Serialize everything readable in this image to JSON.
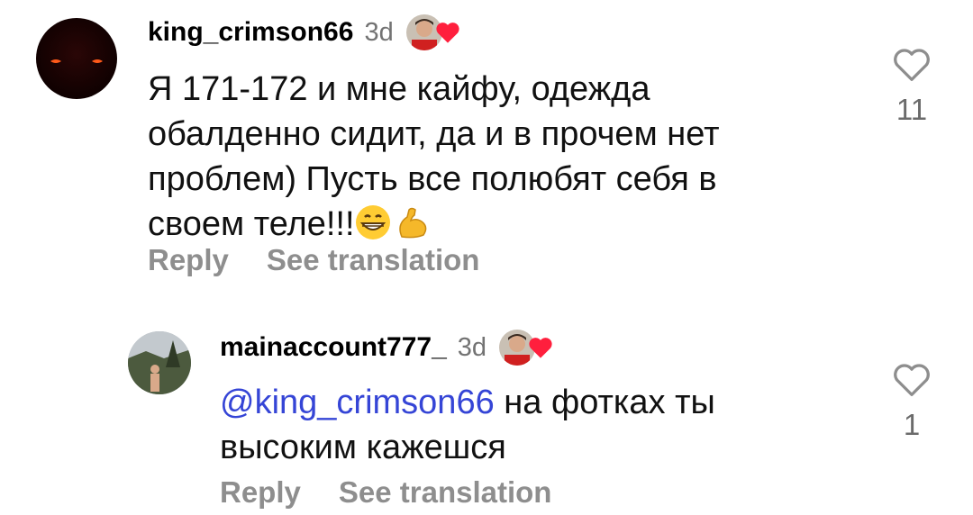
{
  "comments": [
    {
      "username": "king_crimson66",
      "time": "3d",
      "text_lines": [
        "Я 171-172 и мне кайфу, одежда",
        "обалденно сидит, да и в прочем нет",
        "проблем) Пусть все полюбят себя в",
        "своем теле!!!"
      ],
      "emojis": [
        "grinning-face-icon",
        "flexed-biceps-icon"
      ],
      "reply_label": "Reply",
      "translate_label": "See translation",
      "like_count": "11",
      "liked_by_creator": true
    },
    {
      "username": "mainaccount777_",
      "time": "3d",
      "mention": "@king_crimson66",
      "text_after_mention": " на фотках ты",
      "text_line2": "высоким кажешся",
      "reply_label": "Reply",
      "translate_label": "See translation",
      "like_count": "1",
      "liked_by_creator": true
    }
  ],
  "colors": {
    "mention": "#3545d6",
    "heart": "#ff1f3d",
    "secondary_text": "#8e8e8e"
  }
}
